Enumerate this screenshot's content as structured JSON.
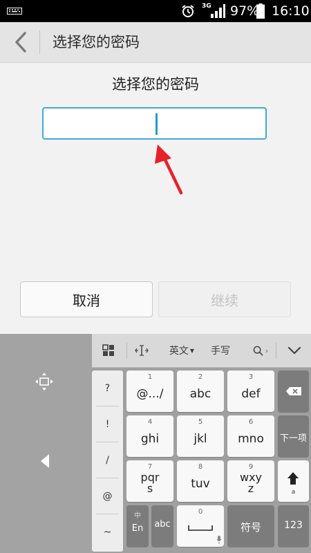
{
  "status_bar": {
    "network": "3G",
    "battery": "97%",
    "time": "16:10"
  },
  "title_bar": {
    "title": "选择您的密码"
  },
  "content": {
    "heading": "选择您的密码",
    "password_value": "",
    "cancel_label": "取消",
    "continue_label": "继续"
  },
  "keyboard": {
    "toolbar": {
      "language": "英文",
      "handwrite": "手写"
    },
    "symbols": [
      "?",
      "!",
      "/",
      "@",
      "~"
    ],
    "keys": {
      "k1": {
        "num": "1",
        "label": "@.../"
      },
      "k2": {
        "num": "2",
        "label": "abc"
      },
      "k3": {
        "num": "3",
        "label": "def"
      },
      "k4": {
        "num": "4",
        "label": "ghi"
      },
      "k5": {
        "num": "5",
        "label": "jkl"
      },
      "k6": {
        "num": "6",
        "label": "mno"
      },
      "k7": {
        "num": "7",
        "label_top": "pqr",
        "label_bottom": "s"
      },
      "k8": {
        "num": "8",
        "label": "tuv"
      },
      "k9": {
        "num": "9",
        "label_top": "wxy",
        "label_bottom": "z"
      },
      "k0": {
        "num": "0"
      },
      "next_item": "下一项",
      "shift_sub": "a",
      "lang_cn": "中",
      "lang_en": "En",
      "abc": "abc",
      "symbol": "符号",
      "num_mode": "123"
    }
  },
  "colors": {
    "accent": "#3fa9d8",
    "arrow": "#e8202a",
    "status_bar": "#000000",
    "keyboard_bg": "#9a9a9a"
  }
}
